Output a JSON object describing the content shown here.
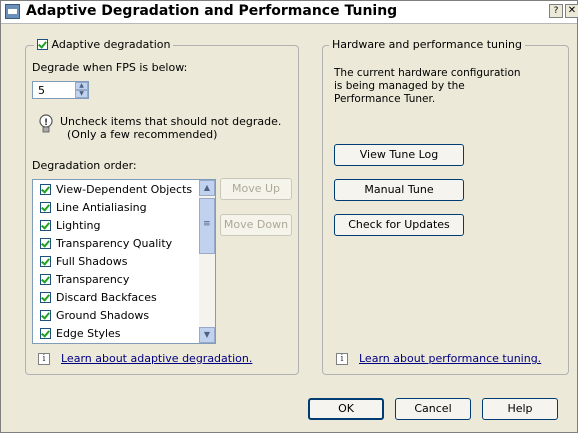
{
  "window": {
    "title": "Adaptive Degradation and Performance Tuning",
    "help_glyph": "?",
    "close_glyph": "✕"
  },
  "left_panel": {
    "legend_label": "Adaptive degradation",
    "legend_checked": true,
    "degrade_label": "Degrade when FPS is below:",
    "fps_value": "5",
    "note_line1": "Uncheck items that should not degrade.",
    "note_line2": "(Only a few recommended)",
    "order_label": "Degradation order:",
    "items": [
      {
        "label": "View-Dependent Objects",
        "checked": true
      },
      {
        "label": "Line Antialiasing",
        "checked": true
      },
      {
        "label": "Lighting",
        "checked": true
      },
      {
        "label": "Transparency Quality",
        "checked": true
      },
      {
        "label": "Full Shadows",
        "checked": true
      },
      {
        "label": "Transparency",
        "checked": true
      },
      {
        "label": "Discard Backfaces",
        "checked": true
      },
      {
        "label": "Ground Shadows",
        "checked": true
      },
      {
        "label": "Edge Styles",
        "checked": true
      }
    ],
    "move_up": "Move Up",
    "move_down": "Move Down",
    "learn_link": "Learn about adaptive degradation."
  },
  "right_panel": {
    "legend_label": "Hardware and performance tuning",
    "status_line1": "The current hardware configuration",
    "status_line2": "is being managed by the",
    "status_line3": "Performance Tuner.",
    "view_log": "View Tune Log",
    "manual_tune": "Manual Tune",
    "check_updates": "Check for Updates",
    "learn_link": "Learn about performance tuning."
  },
  "footer": {
    "ok": "OK",
    "cancel": "Cancel",
    "help": "Help"
  },
  "icons": {
    "info_glyph": "i",
    "spin_up_glyph": "▲",
    "spin_down_glyph": "▼",
    "scroll_up_glyph": "▲",
    "scroll_down_glyph": "▼"
  }
}
